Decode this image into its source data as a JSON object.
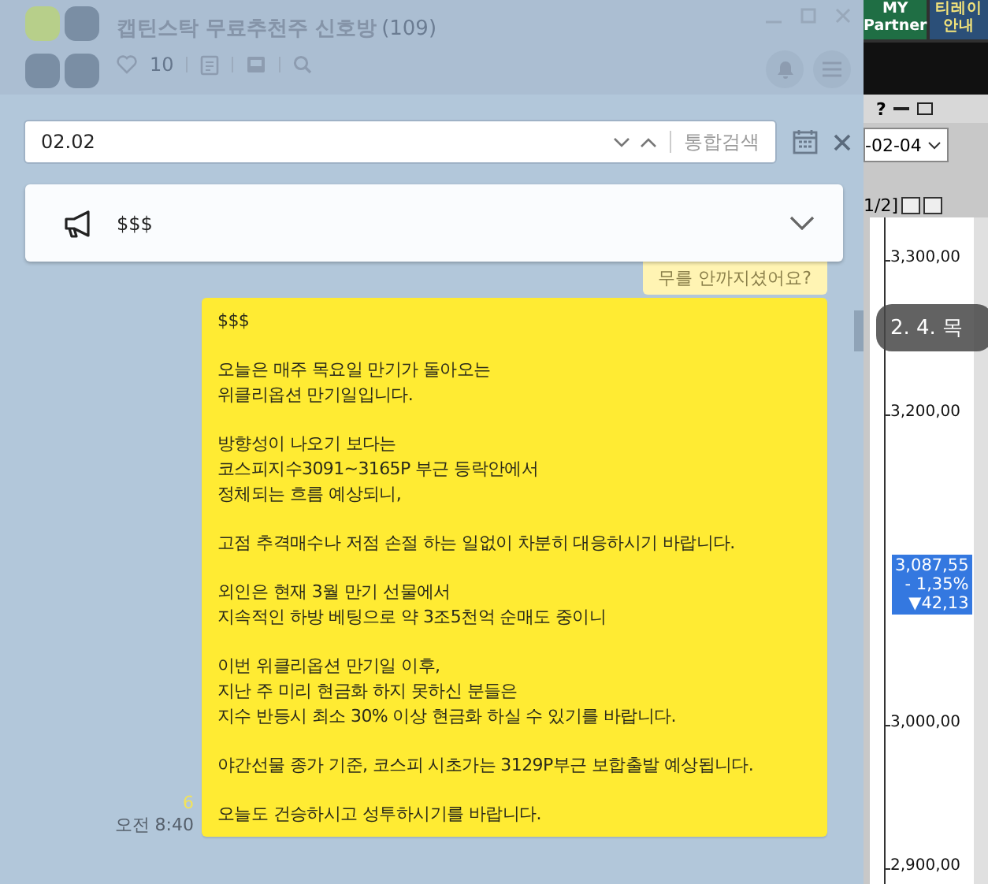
{
  "chat": {
    "title": "캡틴스탁 무료추천주 신호방",
    "member_count": "(109)",
    "likes": "10"
  },
  "search": {
    "value": "02.02",
    "button": "통합검색"
  },
  "notice": {
    "text": "$$$"
  },
  "hidden_message": "무를 안까지셨어요?",
  "message": {
    "paragraphs": [
      [
        "$$$"
      ],
      [
        "오늘은 매주 목요일 만기가 돌아오는",
        "위클리옵션 만기일입니다."
      ],
      [
        "방향성이 나오기 보다는",
        "코스피지수3091~3165P 부근 등락안에서",
        "정체되는 흐름 예상되니,"
      ],
      [
        "고점 추격매수나 저점 손절 하는 일없이 차분히 대응하시기 바랍니다."
      ],
      [
        "외인은 현재 3월 만기 선물에서",
        "지속적인 하방 베팅으로 약 3조5천억 순매도 중이니"
      ],
      [
        "이번 위클리옵션 만기일 이후,",
        "지난 주 미리 현금화 하지 못하신 분들은",
        "지수 반등시 최소 30% 이상 현금화 하실 수 있기를 바랍니다."
      ],
      [
        "야간선물 종가 기준, 코스피 시초가는 3129P부근 보합출발 예상됩니다."
      ],
      [
        "오늘도 건승하시고 성투하시기를 바랍니다."
      ]
    ],
    "unread": "6",
    "time": "오전 8:40"
  },
  "date_badge": "2. 4. 목",
  "background_app": {
    "tabs": [
      {
        "line1": "MY",
        "line2": "Partner"
      },
      {
        "line1": "티레이",
        "line2": "안내"
      }
    ],
    "help": "?",
    "date_field": "-02-04",
    "page_indicator": "1/2]",
    "y_labels": [
      "3,300,00",
      "3,200,00",
      "3,000,00",
      "2,900,00"
    ],
    "price_tag": [
      "3,087,55",
      "- 1,35%",
      "▼42,13"
    ]
  }
}
